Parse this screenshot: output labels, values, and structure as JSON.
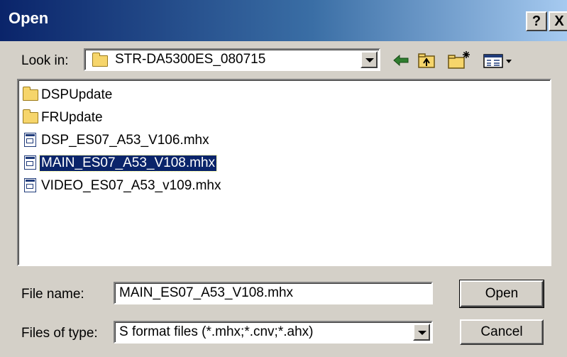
{
  "window": {
    "title": "Open",
    "help_label": "?",
    "close_label": "X"
  },
  "lookin": {
    "label": "Look in:",
    "value": "STR-DA5300ES_080715",
    "toolbar_icons": [
      "back-arrow-icon",
      "up-folder-icon",
      "new-folder-icon",
      "view-menu-icon"
    ]
  },
  "files": {
    "items": [
      {
        "name": "DSPUpdate",
        "type": "folder"
      },
      {
        "name": "FRUpdate",
        "type": "folder"
      },
      {
        "name": "DSP_ES07_A53_V106.mhx",
        "type": "file"
      },
      {
        "name": "MAIN_ES07_A53_V108.mhx",
        "type": "file",
        "selected": true
      },
      {
        "name": "VIDEO_ES07_A53_v109.mhx",
        "type": "file"
      }
    ]
  },
  "filename": {
    "label": "File name:",
    "value": "MAIN_ES07_A53_V108.mhx"
  },
  "filetype": {
    "label": "Files of type:",
    "value": "S format files (*.mhx;*.cnv;*.ahx)"
  },
  "buttons": {
    "open_label": "Open",
    "cancel_label": "Cancel"
  },
  "colors": {
    "title_bar": "#0a246a",
    "dialog_bg": "#d4d0c8",
    "selection_bg": "#0a246a",
    "folder_icon": "#f6d56b"
  }
}
